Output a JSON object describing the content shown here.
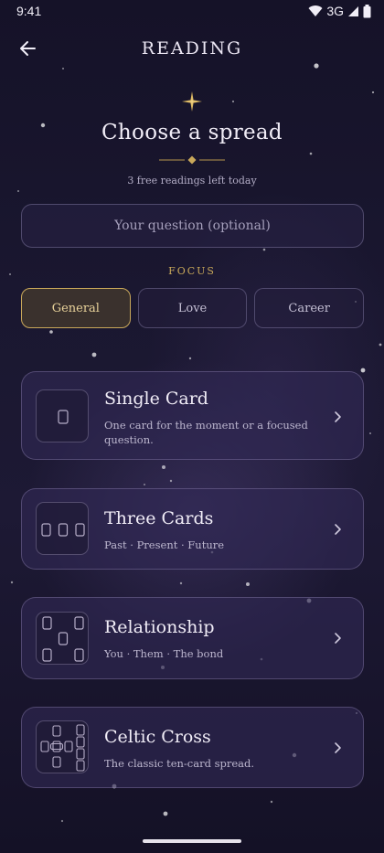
{
  "status_bar": {
    "time": "9:41",
    "network": "3G"
  },
  "header": {
    "title": "READING"
  },
  "intro": {
    "heading": "Choose a spread",
    "subtitle": "3 free readings left today"
  },
  "question": {
    "placeholder": "Your question (optional)",
    "value": ""
  },
  "focus": {
    "label": "FOCUS",
    "options": [
      "General",
      "Love",
      "Career"
    ],
    "selected": "General"
  },
  "spreads": [
    {
      "title": "Single Card",
      "description": "One card for the moment or a focused question."
    },
    {
      "title": "Three Cards",
      "description": "Past · Present · Future"
    },
    {
      "title": "Relationship",
      "description": "You · Them · The bond"
    },
    {
      "title": "Celtic Cross",
      "description": "The classic ten-card spread."
    }
  ],
  "colors": {
    "accent_gold": "#c9a85a",
    "background": "#1a1730",
    "card": "#30284f"
  },
  "icons": {
    "back": "arrow-left-icon",
    "sparkle": "sparkle-icon",
    "chevron": "chevron-right-icon",
    "wifi": "wifi-icon",
    "signal": "signal-icon",
    "battery": "battery-icon"
  }
}
